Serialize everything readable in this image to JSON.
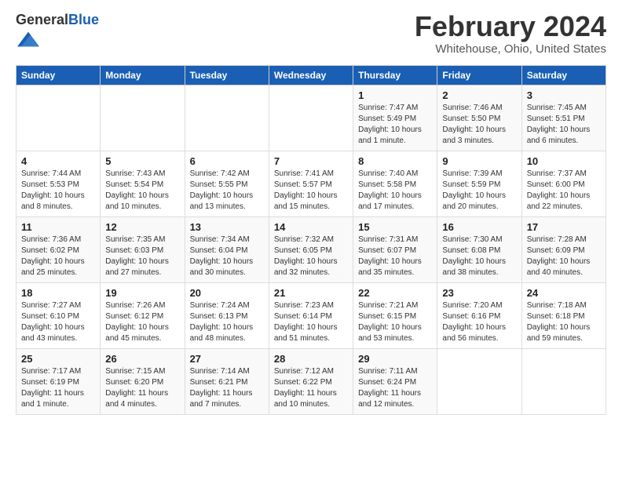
{
  "header": {
    "logo_general": "General",
    "logo_blue": "Blue",
    "month_year": "February 2024",
    "location": "Whitehouse, Ohio, United States"
  },
  "days_of_week": [
    "Sunday",
    "Monday",
    "Tuesday",
    "Wednesday",
    "Thursday",
    "Friday",
    "Saturday"
  ],
  "weeks": [
    [
      {
        "day": "",
        "info": ""
      },
      {
        "day": "",
        "info": ""
      },
      {
        "day": "",
        "info": ""
      },
      {
        "day": "",
        "info": ""
      },
      {
        "day": "1",
        "info": "Sunrise: 7:47 AM\nSunset: 5:49 PM\nDaylight: 10 hours and 1 minute."
      },
      {
        "day": "2",
        "info": "Sunrise: 7:46 AM\nSunset: 5:50 PM\nDaylight: 10 hours and 3 minutes."
      },
      {
        "day": "3",
        "info": "Sunrise: 7:45 AM\nSunset: 5:51 PM\nDaylight: 10 hours and 6 minutes."
      }
    ],
    [
      {
        "day": "4",
        "info": "Sunrise: 7:44 AM\nSunset: 5:53 PM\nDaylight: 10 hours and 8 minutes."
      },
      {
        "day": "5",
        "info": "Sunrise: 7:43 AM\nSunset: 5:54 PM\nDaylight: 10 hours and 10 minutes."
      },
      {
        "day": "6",
        "info": "Sunrise: 7:42 AM\nSunset: 5:55 PM\nDaylight: 10 hours and 13 minutes."
      },
      {
        "day": "7",
        "info": "Sunrise: 7:41 AM\nSunset: 5:57 PM\nDaylight: 10 hours and 15 minutes."
      },
      {
        "day": "8",
        "info": "Sunrise: 7:40 AM\nSunset: 5:58 PM\nDaylight: 10 hours and 17 minutes."
      },
      {
        "day": "9",
        "info": "Sunrise: 7:39 AM\nSunset: 5:59 PM\nDaylight: 10 hours and 20 minutes."
      },
      {
        "day": "10",
        "info": "Sunrise: 7:37 AM\nSunset: 6:00 PM\nDaylight: 10 hours and 22 minutes."
      }
    ],
    [
      {
        "day": "11",
        "info": "Sunrise: 7:36 AM\nSunset: 6:02 PM\nDaylight: 10 hours and 25 minutes."
      },
      {
        "day": "12",
        "info": "Sunrise: 7:35 AM\nSunset: 6:03 PM\nDaylight: 10 hours and 27 minutes."
      },
      {
        "day": "13",
        "info": "Sunrise: 7:34 AM\nSunset: 6:04 PM\nDaylight: 10 hours and 30 minutes."
      },
      {
        "day": "14",
        "info": "Sunrise: 7:32 AM\nSunset: 6:05 PM\nDaylight: 10 hours and 32 minutes."
      },
      {
        "day": "15",
        "info": "Sunrise: 7:31 AM\nSunset: 6:07 PM\nDaylight: 10 hours and 35 minutes."
      },
      {
        "day": "16",
        "info": "Sunrise: 7:30 AM\nSunset: 6:08 PM\nDaylight: 10 hours and 38 minutes."
      },
      {
        "day": "17",
        "info": "Sunrise: 7:28 AM\nSunset: 6:09 PM\nDaylight: 10 hours and 40 minutes."
      }
    ],
    [
      {
        "day": "18",
        "info": "Sunrise: 7:27 AM\nSunset: 6:10 PM\nDaylight: 10 hours and 43 minutes."
      },
      {
        "day": "19",
        "info": "Sunrise: 7:26 AM\nSunset: 6:12 PM\nDaylight: 10 hours and 45 minutes."
      },
      {
        "day": "20",
        "info": "Sunrise: 7:24 AM\nSunset: 6:13 PM\nDaylight: 10 hours and 48 minutes."
      },
      {
        "day": "21",
        "info": "Sunrise: 7:23 AM\nSunset: 6:14 PM\nDaylight: 10 hours and 51 minutes."
      },
      {
        "day": "22",
        "info": "Sunrise: 7:21 AM\nSunset: 6:15 PM\nDaylight: 10 hours and 53 minutes."
      },
      {
        "day": "23",
        "info": "Sunrise: 7:20 AM\nSunset: 6:16 PM\nDaylight: 10 hours and 56 minutes."
      },
      {
        "day": "24",
        "info": "Sunrise: 7:18 AM\nSunset: 6:18 PM\nDaylight: 10 hours and 59 minutes."
      }
    ],
    [
      {
        "day": "25",
        "info": "Sunrise: 7:17 AM\nSunset: 6:19 PM\nDaylight: 11 hours and 1 minute."
      },
      {
        "day": "26",
        "info": "Sunrise: 7:15 AM\nSunset: 6:20 PM\nDaylight: 11 hours and 4 minutes."
      },
      {
        "day": "27",
        "info": "Sunrise: 7:14 AM\nSunset: 6:21 PM\nDaylight: 11 hours and 7 minutes."
      },
      {
        "day": "28",
        "info": "Sunrise: 7:12 AM\nSunset: 6:22 PM\nDaylight: 11 hours and 10 minutes."
      },
      {
        "day": "29",
        "info": "Sunrise: 7:11 AM\nSunset: 6:24 PM\nDaylight: 11 hours and 12 minutes."
      },
      {
        "day": "",
        "info": ""
      },
      {
        "day": "",
        "info": ""
      }
    ]
  ]
}
